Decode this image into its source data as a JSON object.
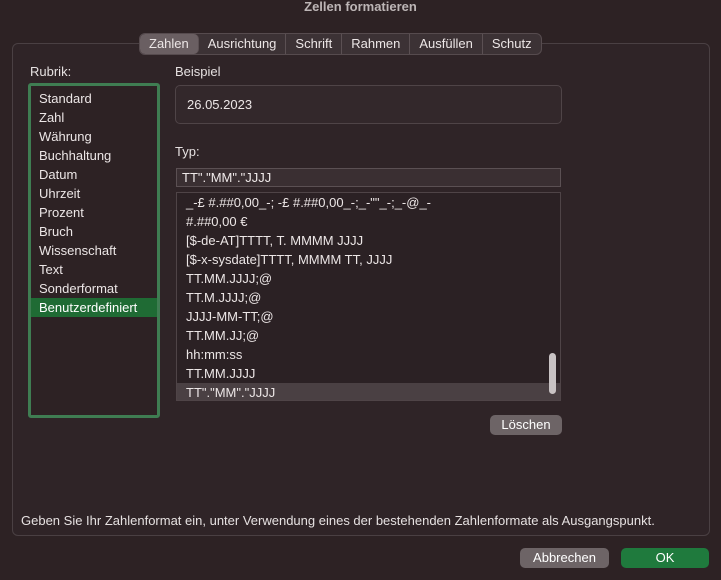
{
  "window": {
    "title": "Zellen formatieren"
  },
  "tabs": [
    {
      "label": "Zahlen",
      "active": true
    },
    {
      "label": "Ausrichtung",
      "active": false
    },
    {
      "label": "Schrift",
      "active": false
    },
    {
      "label": "Rahmen",
      "active": false
    },
    {
      "label": "Ausfüllen",
      "active": false
    },
    {
      "label": "Schutz",
      "active": false
    }
  ],
  "rubrik": {
    "label": "Rubrik:",
    "items": [
      "Standard",
      "Zahl",
      "Währung",
      "Buchhaltung",
      "Datum",
      "Uhrzeit",
      "Prozent",
      "Bruch",
      "Wissenschaft",
      "Text",
      "Sonderformat",
      "Benutzerdefiniert"
    ],
    "selected": "Benutzerdefiniert"
  },
  "beispiel": {
    "label": "Beispiel",
    "value": "26.05.2023"
  },
  "typ": {
    "label": "Typ:",
    "input_value": "TT\".\"MM\".\"JJJJ",
    "items": [
      "_-£ #.##0,00_-; -£ #.##0,00_-;_-\"\"_-;_-@_-",
      "#.##0,00 €",
      "[$-de-AT]TTTT, T. MMMM JJJJ",
      "[$-x-sysdate]TTTT, MMMM TT, JJJJ",
      "TT.MM.JJJJ;@",
      "TT.M.JJJJ;@",
      "JJJJ-MM-TT;@",
      "TT.MM.JJ;@",
      "hh:mm:ss",
      "TT.MM.JJJJ",
      "TT\".\"MM\".\"JJJJ"
    ],
    "selected": "TT\".\"MM\".\"JJJJ"
  },
  "buttons": {
    "delete": "Löschen",
    "cancel": "Abbrechen",
    "ok": "OK"
  },
  "hint": "Geben Sie Ihr Zahlenformat ein, unter Verwendung eines der bestehenden Zahlenformate als Ausgangspunkt.",
  "colors": {
    "accent_green": "#1f7a3d",
    "selection_green": "#1f6b34",
    "list_border_green": "#3f7d52"
  }
}
